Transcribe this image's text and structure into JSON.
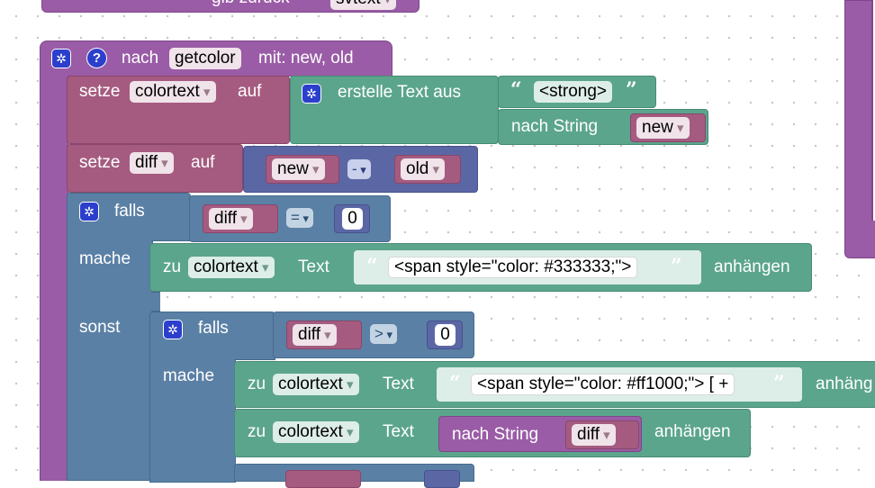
{
  "top_block": {
    "label": "gib zurück",
    "var": "svtext"
  },
  "procedure": {
    "prefix": "nach",
    "name": "getcolor",
    "params": "mit: new, old",
    "gear_icon": "gear-icon",
    "help_icon": "question-icon"
  },
  "set1": {
    "setze": "setze",
    "var": "colortext",
    "auf": "auf",
    "create_text": "erstelle Text aus",
    "text_value": "<strong>",
    "to_string": "nach String",
    "to_string_var": "new"
  },
  "set2": {
    "setze": "setze",
    "var": "diff",
    "auf": "auf",
    "left": "new",
    "op": "-",
    "right": "old"
  },
  "if1": {
    "falls": "falls",
    "var": "diff",
    "op": "=",
    "value": "0",
    "mache": "mache",
    "sonst": "sonst"
  },
  "append1": {
    "zu": "zu",
    "var": "colortext",
    "text_label": "Text",
    "value": "<span style=\"color: #333333;\">",
    "suffix": "anhängen"
  },
  "if2": {
    "falls": "falls",
    "var": "diff",
    "op": ">",
    "value": "0",
    "mache": "mache"
  },
  "append2": {
    "zu": "zu",
    "var": "colortext",
    "text_label": "Text",
    "value": "<span style=\"color: #ff1000;\"> [ +",
    "suffix": "anhäng"
  },
  "append3": {
    "zu": "zu",
    "var": "colortext",
    "text_label": "Text",
    "to_string": "nach String",
    "var2": "diff",
    "suffix": "anhängen"
  },
  "colors": {
    "procedure": "#9a5ca6",
    "variable": "#a55b80",
    "logic": "#5b80a5",
    "text": "#5ba58c",
    "math": "#5b67a5",
    "gear": "#2c3fcc"
  }
}
